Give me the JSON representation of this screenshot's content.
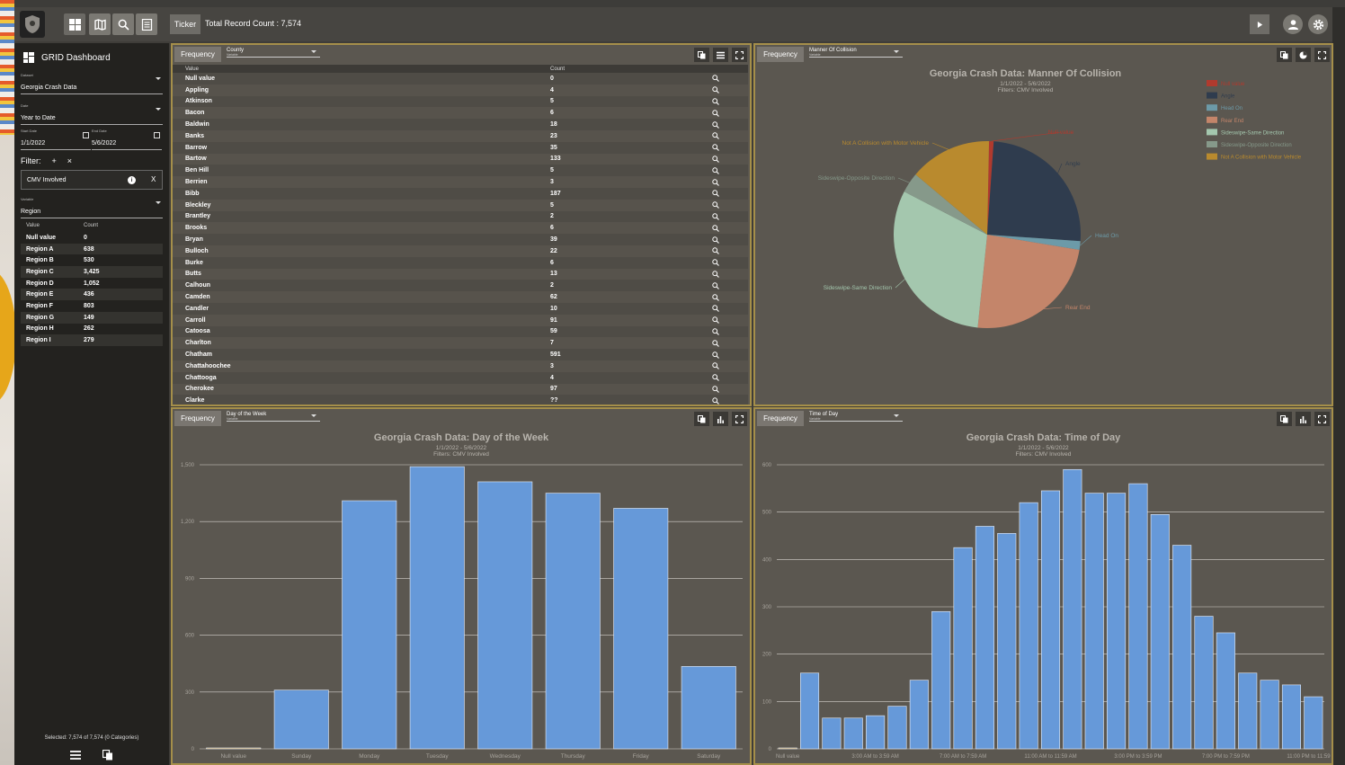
{
  "topbar": {
    "ticker_label": "Ticker",
    "record_count": "Total Record Count : 7,574"
  },
  "sidebar": {
    "title": "GRID Dashboard",
    "dataset": {
      "label": "Dataset",
      "value": "Georgia Crash Data"
    },
    "date": {
      "label": "Date",
      "value": "Year to Date"
    },
    "start_date": {
      "label": "Start Date",
      "value": "1/1/2022"
    },
    "end_date": {
      "label": "End Date",
      "value": "5/6/2022"
    },
    "filter_label": "Filter:",
    "filter_add": "+",
    "filter_clear": "×",
    "filter_chip": {
      "text": "CMV Involved",
      "info": "i",
      "remove": "X"
    },
    "variable": {
      "label": "Variable",
      "value": "Region"
    },
    "table": {
      "headers": [
        "Value",
        "Count"
      ],
      "rows": [
        [
          "Null value",
          "0"
        ],
        [
          "Region A",
          "638"
        ],
        [
          "Region B",
          "530"
        ],
        [
          "Region C",
          "3,425"
        ],
        [
          "Region D",
          "1,052"
        ],
        [
          "Region E",
          "436"
        ],
        [
          "Region F",
          "803"
        ],
        [
          "Region G",
          "149"
        ],
        [
          "Region H",
          "262"
        ],
        [
          "Region I",
          "279"
        ]
      ]
    },
    "selected": "Selected: 7,574 of 7,574 (0 Categories)"
  },
  "panel_county": {
    "freq_label": "Frequency",
    "variable_value": "County",
    "variable_label": "Variable",
    "headers": [
      "Value",
      "Count"
    ],
    "rows": [
      [
        "Null value",
        "0"
      ],
      [
        "Appling",
        "4"
      ],
      [
        "Atkinson",
        "5"
      ],
      [
        "Bacon",
        "6"
      ],
      [
        "Baldwin",
        "18"
      ],
      [
        "Banks",
        "23"
      ],
      [
        "Barrow",
        "35"
      ],
      [
        "Bartow",
        "133"
      ],
      [
        "Ben Hill",
        "5"
      ],
      [
        "Berrien",
        "3"
      ],
      [
        "Bibb",
        "187"
      ],
      [
        "Bleckley",
        "5"
      ],
      [
        "Brantley",
        "2"
      ],
      [
        "Brooks",
        "6"
      ],
      [
        "Bryan",
        "39"
      ],
      [
        "Bulloch",
        "22"
      ],
      [
        "Burke",
        "6"
      ],
      [
        "Butts",
        "13"
      ],
      [
        "Calhoun",
        "2"
      ],
      [
        "Camden",
        "62"
      ],
      [
        "Candler",
        "10"
      ],
      [
        "Carroll",
        "91"
      ],
      [
        "Catoosa",
        "59"
      ],
      [
        "Charlton",
        "7"
      ],
      [
        "Chatham",
        "591"
      ],
      [
        "Chattahoochee",
        "3"
      ],
      [
        "Chattooga",
        "4"
      ],
      [
        "Cherokee",
        "97"
      ],
      [
        "Clarke",
        "??"
      ]
    ]
  },
  "panel_collision": {
    "freq_label": "Frequency",
    "variable_value": "Manner Of Collision",
    "variable_label": "Variable",
    "chart_data": {
      "type": "pie",
      "title": "Georgia Crash Data: Manner Of Collision",
      "subtitle": "1/1/2022 - 5/6/2022",
      "subtitle2": "Filters: CMV Involved",
      "legend_position": "top-right",
      "slices": [
        {
          "name": "Null value",
          "value": 0.8,
          "color": "#b03a2e"
        },
        {
          "name": "Angle",
          "value": 25,
          "color": "#2f3c4e"
        },
        {
          "name": "Head On",
          "value": 1.5,
          "color": "#6c9aa8"
        },
        {
          "name": "Rear End",
          "value": 24,
          "color": "#c4856a"
        },
        {
          "name": "Sideswipe-Same Direction",
          "value": 31,
          "color": "#a4c7ae"
        },
        {
          "name": "Sideswipe-Opposite Direction",
          "value": 3.5,
          "color": "#86998a"
        },
        {
          "name": "Not A Collision with Motor Vehicle",
          "value": 14.2,
          "color": "#b98a2e"
        }
      ]
    }
  },
  "panel_dow": {
    "freq_label": "Frequency",
    "variable_value": "Day of the Week",
    "variable_label": "Variable",
    "chart_data": {
      "type": "bar",
      "title": "Georgia Crash Data: Day of the Week",
      "subtitle": "1/1/2022 - 5/6/2022",
      "subtitle2": "Filters: CMV Involved",
      "categories": [
        "Null value",
        "Sunday",
        "Monday",
        "Tuesday",
        "Wednesday",
        "Thursday",
        "Friday",
        "Saturday"
      ],
      "values": [
        0,
        310,
        1310,
        1490,
        1410,
        1350,
        1270,
        435
      ],
      "ylim": [
        0,
        1500
      ],
      "yticks": [
        0,
        300,
        600,
        900,
        1200,
        1500
      ],
      "yticklabels": [
        "0",
        "300",
        "600",
        "900",
        "1,200",
        "1,500"
      ],
      "grid": true,
      "color": "#6699d9"
    }
  },
  "panel_tod": {
    "freq_label": "Frequency",
    "variable_value": "Time of Day",
    "variable_label": "Variable",
    "chart_data": {
      "type": "bar",
      "title": "Georgia Crash Data: Time of Day",
      "subtitle": "1/1/2022 - 5/6/2022",
      "subtitle2": "Filters: CMV Involved",
      "values": [
        0,
        160,
        65,
        65,
        70,
        90,
        145,
        290,
        425,
        470,
        455,
        520,
        545,
        590,
        540,
        540,
        560,
        495,
        430,
        280,
        245,
        160,
        145,
        135,
        110
      ],
      "xticklabels": [
        {
          "index": 0,
          "label": "Null value"
        },
        {
          "index": 4,
          "label": "3:00 AM to 3:59 AM"
        },
        {
          "index": 8,
          "label": "7:00 AM to 7:59 AM"
        },
        {
          "index": 12,
          "label": "11:00 AM to 11:59 AM"
        },
        {
          "index": 16,
          "label": "3:00 PM to 3:59 PM"
        },
        {
          "index": 20,
          "label": "7:00 PM to 7:59 PM"
        },
        {
          "index": 24,
          "label": "11:00 PM to 11:59 PM"
        }
      ],
      "ylim": [
        0,
        600
      ],
      "yticks": [
        0,
        100,
        200,
        300,
        400,
        500,
        600
      ],
      "yticklabels": [
        "0",
        "100",
        "200",
        "300",
        "400",
        "500",
        "600"
      ],
      "grid": true,
      "color": "#6699d9"
    }
  },
  "colors": {
    "panel_border": "#a58f4a",
    "bar": "#6699d9",
    "panel_bg": "#5b5750",
    "sidebar_bg": "#23221f"
  }
}
